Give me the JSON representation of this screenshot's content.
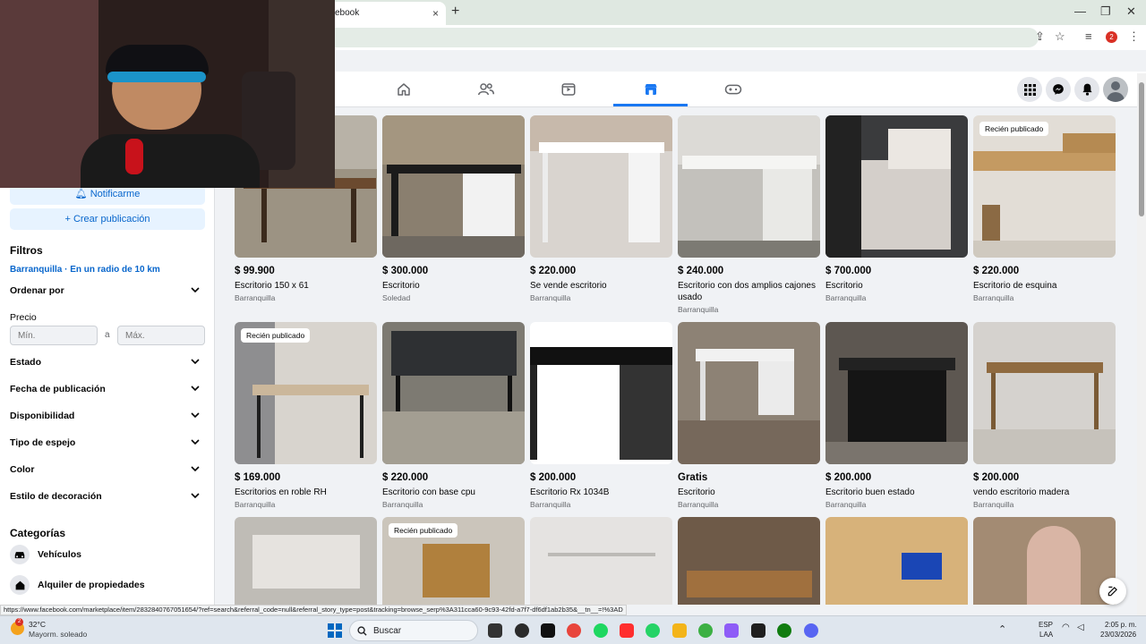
{
  "browser": {
    "tab_title": "ebook",
    "tab_close": "×",
    "new_tab": "+",
    "ext_badge": "2"
  },
  "sidebar": {
    "notify_label": "Notificarme",
    "create_label": "Crear publicación",
    "filters_heading": "Filtros",
    "location_label": "Barranquilla · En un radio de 10 km",
    "sort_label": "Ordenar por",
    "price_heading": "Precio",
    "price_min_placeholder": "Mín.",
    "price_to": "a",
    "price_max_placeholder": "Máx.",
    "filters": [
      "Estado",
      "Fecha de publicación",
      "Disponibilidad",
      "Tipo de espejo",
      "Color",
      "Estilo de decoración"
    ],
    "categories_heading": "Categorías",
    "categories": [
      "Vehículos",
      "Alquiler de propiedades"
    ]
  },
  "listings": [
    {
      "price": "$ 99.900",
      "title": "Escritorio 150 x 61",
      "location": "Barranquilla",
      "badge": ""
    },
    {
      "price": "$ 300.000",
      "title": "Escritorio",
      "location": "Soledad",
      "badge": ""
    },
    {
      "price": "$ 220.000",
      "title": "Se vende escritorio",
      "location": "Barranquilla",
      "badge": ""
    },
    {
      "price": "$ 240.000",
      "title": "Escritorio con dos amplios cajones usado",
      "location": "Barranquilla",
      "badge": ""
    },
    {
      "price": "$ 700.000",
      "title": "Escritorio",
      "location": "Barranquilla",
      "badge": ""
    },
    {
      "price": "$ 220.000",
      "title": "Escritorio de esquina",
      "location": "Barranquilla",
      "badge": "Recién publicado"
    },
    {
      "price": "$ 169.000",
      "title": "Escritorios en roble RH",
      "location": "Barranquilla",
      "badge": "Recién publicado"
    },
    {
      "price": "$ 220.000",
      "title": "Escritorio con base cpu",
      "location": "Barranquilla",
      "badge": ""
    },
    {
      "price": "$ 200.000",
      "title": "Escritorio Rx 1034B",
      "location": "Barranquilla",
      "badge": ""
    },
    {
      "price": "Gratis",
      "title": "Escritorio",
      "location": "Barranquilla",
      "badge": ""
    },
    {
      "price": "$ 200.000",
      "title": "Escritorio buen estado",
      "location": "Barranquilla",
      "badge": ""
    },
    {
      "price": "$ 200.000",
      "title": "vendo escritorio madera",
      "location": "Barranquilla",
      "badge": ""
    },
    {
      "price": "",
      "title": "",
      "location": "",
      "badge": ""
    },
    {
      "price": "",
      "title": "",
      "location": "",
      "badge": "Recién publicado"
    },
    {
      "price": "",
      "title": "",
      "location": "",
      "badge": ""
    },
    {
      "price": "",
      "title": "",
      "location": "",
      "badge": ""
    },
    {
      "price": "",
      "title": "",
      "location": "",
      "badge": ""
    },
    {
      "price": "",
      "title": "",
      "location": "",
      "badge": ""
    }
  ],
  "status_url": "https://www.facebook.com/marketplace/item/2832840767051654/?ref=search&referral_code=null&referral_story_type=post&tracking=browse_serp%3A311cca60-9c93-42fd-a7f7-df6df1ab2b35&__tn__=!%3AD",
  "taskbar": {
    "weather_temp": "32°C",
    "weather_desc": "Mayorm. soleado",
    "weather_badge": "2",
    "search_label": "Buscar",
    "lang_top": "ESP",
    "lang_bottom": "LAA",
    "time": "2:05 p. m.",
    "date": "23/03/2026"
  },
  "colors": {
    "accent": "#1877f2",
    "link": "#0866cc"
  }
}
